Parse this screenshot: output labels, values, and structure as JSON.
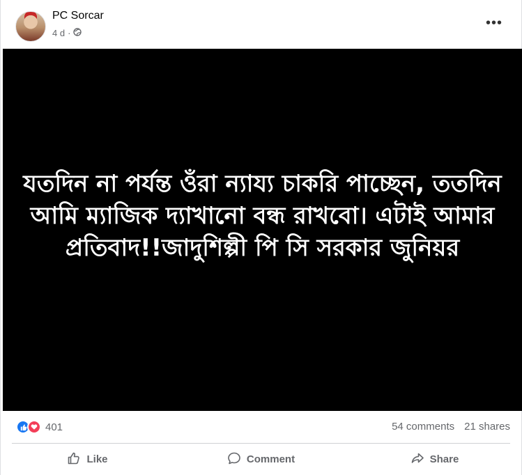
{
  "post": {
    "author": "PC Sorcar",
    "time": "4 d",
    "separator": "·",
    "more_label": "•••",
    "media_text": "যতদিন না পর্যন্ত ওঁরা ন্যায্য চাকরি পাচ্ছেন, ততদিন আমি ম্যাজিক দ্যাখানো বন্ধ রাখবো। এটাই আমার প্রতিবাদ!!জাদুশিল্পী পি সি সরকার জুনিয়র"
  },
  "stats": {
    "reactions_count": "401",
    "comments": "54 comments",
    "shares": "21 shares"
  },
  "actions": {
    "like": "Like",
    "comment": "Comment",
    "share": "Share"
  },
  "colors": {
    "accent_blue": "#1877f2",
    "love_red": "#f33e58",
    "muted": "#65676b",
    "media_bg": "#000000"
  }
}
